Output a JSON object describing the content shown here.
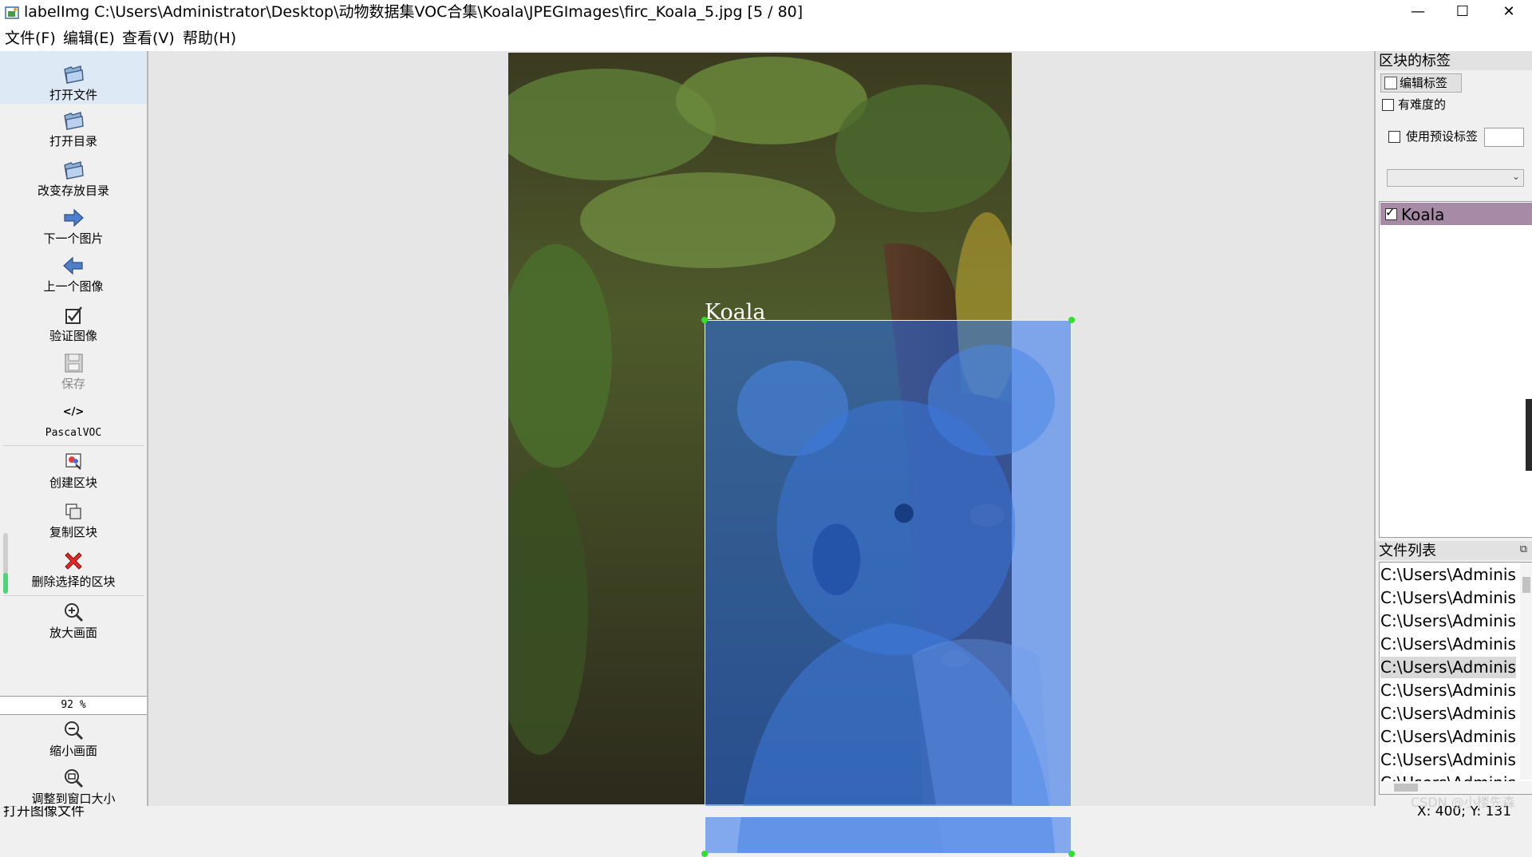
{
  "window": {
    "title": "labelImg C:\\Users\\Administrator\\Desktop\\动物数据集VOC合集\\Koala\\JPEGImages\\firc_Koala_5.jpg [5 / 80]",
    "minimize_glyph": "—",
    "maximize_glyph": "☐",
    "close_glyph": "✕"
  },
  "menu": [
    "文件(F)",
    "编辑(E)",
    "查看(V)",
    "帮助(H)"
  ],
  "toolbar": {
    "open_file": "打开文件",
    "open_dir": "打开目录",
    "change_save_dir": "改变存放目录",
    "next_image": "下一个图片",
    "prev_image": "上一个图像",
    "verify_image": "验证图像",
    "save": "保存",
    "format_icon": "</>",
    "format": "PascalVOC",
    "create_box": "创建区块",
    "duplicate_box": "复制区块",
    "delete_box": "删除选择的区块",
    "zoom_in": "放大画面",
    "zoom_value": "92 %",
    "zoom_out": "缩小画面",
    "fit_window": "调整到窗口大小",
    "more": "⌄"
  },
  "canvas": {
    "box_label": "Koala"
  },
  "box_labels_panel": {
    "title": "区块的标签",
    "edit_button": "编辑标签",
    "difficult": "有难度的",
    "use_default_label": "使用预设标签",
    "combo_arrow": "⌄",
    "labels": [
      {
        "text": "Koala",
        "checked": true,
        "color": "#a78aa6"
      }
    ]
  },
  "file_list_panel": {
    "title": "文件列表",
    "float_glyph": "⧉",
    "files": [
      "C:\\Users\\Administ",
      "C:\\Users\\Administ",
      "C:\\Users\\Administ",
      "C:\\Users\\Administ",
      "C:\\Users\\Administ",
      "C:\\Users\\Administ",
      "C:\\Users\\Administ",
      "C:\\Users\\Administ",
      "C:\\Users\\Administ",
      "C:\\Users\\Administ"
    ],
    "selected_index": 4
  },
  "status": {
    "message": "打开图像文件",
    "coords": "X: 400; Y: 131"
  },
  "watermark": "CSDN @小楼先森",
  "colors": {
    "box_fill": "#286eeb",
    "handle": "#2fe02f",
    "label_highlight": "#a78aa6",
    "active_tool": "#dde9f5"
  }
}
